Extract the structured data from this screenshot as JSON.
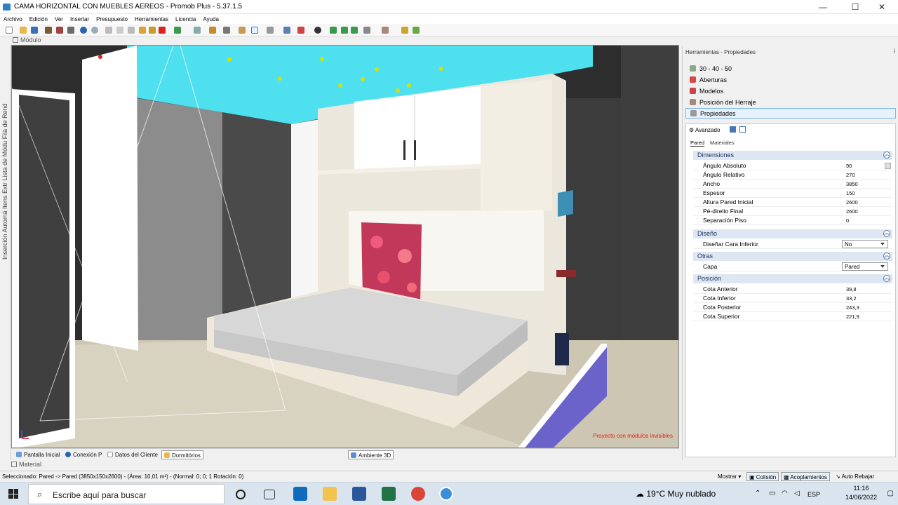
{
  "window": {
    "title": "CAMA HORIZONTAL CON MUEBLES AEREOS - Promob Plus - 5.37.1.5",
    "min": "—",
    "max": "☐",
    "close": "✕"
  },
  "menu": [
    "Archivo",
    "Edición",
    "Ver",
    "Insertar",
    "Presupuesto",
    "Herramientas",
    "Licencia",
    "Ayuda"
  ],
  "modulo_tab": "Módulo",
  "left_strip": "Inserción Automá  Itens Extr  Lista de Módu  Fila de Rend",
  "viewport": {
    "overlay": "Proyecto con módulos invisibles"
  },
  "bottom_tabs": [
    "Pantalla Inicial",
    "Conexión P",
    "Datos del Cliente",
    "Dormitórios",
    "Ambiente 3D"
  ],
  "material_tab": "Material",
  "status": {
    "text": "Seleccionado: Pared -> Pared (3850x150x2600) - (Área: 10,01 m²) - (Normal: 0; 0; 1 Rotación: 0)",
    "mostrar": "Mostrar",
    "colision": "Colisión",
    "acoplamientos": "Acoplamientos",
    "autorebajar": "Auto Rebajar"
  },
  "panel": {
    "title": "Herramientas - Propiedades",
    "items": [
      "30 - 40 - 50",
      "Aberturas",
      "Modelos",
      "Posición del Herraje",
      "Propiedades"
    ],
    "avanzado": "Avanzado",
    "subtabs": [
      "Pared",
      "Materiales"
    ],
    "sections": {
      "dimensiones": {
        "label": "Dimensiones",
        "rows": [
          {
            "k": "Ángulo Absoluto",
            "v": "90"
          },
          {
            "k": "Ángulo Relativo",
            "v": "270"
          },
          {
            "k": "Ancho",
            "v": "3850"
          },
          {
            "k": "Espesor",
            "v": "150"
          },
          {
            "k": "Altura Pared Inicial",
            "v": "2600"
          },
          {
            "k": "Pé-direito Final",
            "v": "2600"
          },
          {
            "k": "Separación Piso",
            "v": "0"
          }
        ]
      },
      "diseno": {
        "label": "Diseño",
        "rows": [
          {
            "k": "Diseñar Cara Inferior",
            "v": "No"
          }
        ]
      },
      "otras": {
        "label": "Otras",
        "rows": [
          {
            "k": "Capa",
            "v": "Pared"
          }
        ]
      },
      "posicion": {
        "label": "Posición",
        "rows": [
          {
            "k": "Cota Anterior",
            "v": "39,8"
          },
          {
            "k": "Cota Inferior",
            "v": "33,2"
          },
          {
            "k": "Cota Posterior",
            "v": "243,3"
          },
          {
            "k": "Cota Superior",
            "v": "221,9"
          }
        ]
      }
    }
  },
  "taskbar": {
    "search": "Escribe aquí para buscar",
    "weather": "19°C  Muy nublado",
    "lang": "ESP",
    "time": "11:16",
    "date": "14/06/2022"
  },
  "colors": {
    "accent": "#0078d7",
    "ceiling_cyan": "#49e0ee",
    "ceiling_dark": "#2e2e2e",
    "floor": "#cfc8b6",
    "selected_wall": "#6b63c9"
  }
}
